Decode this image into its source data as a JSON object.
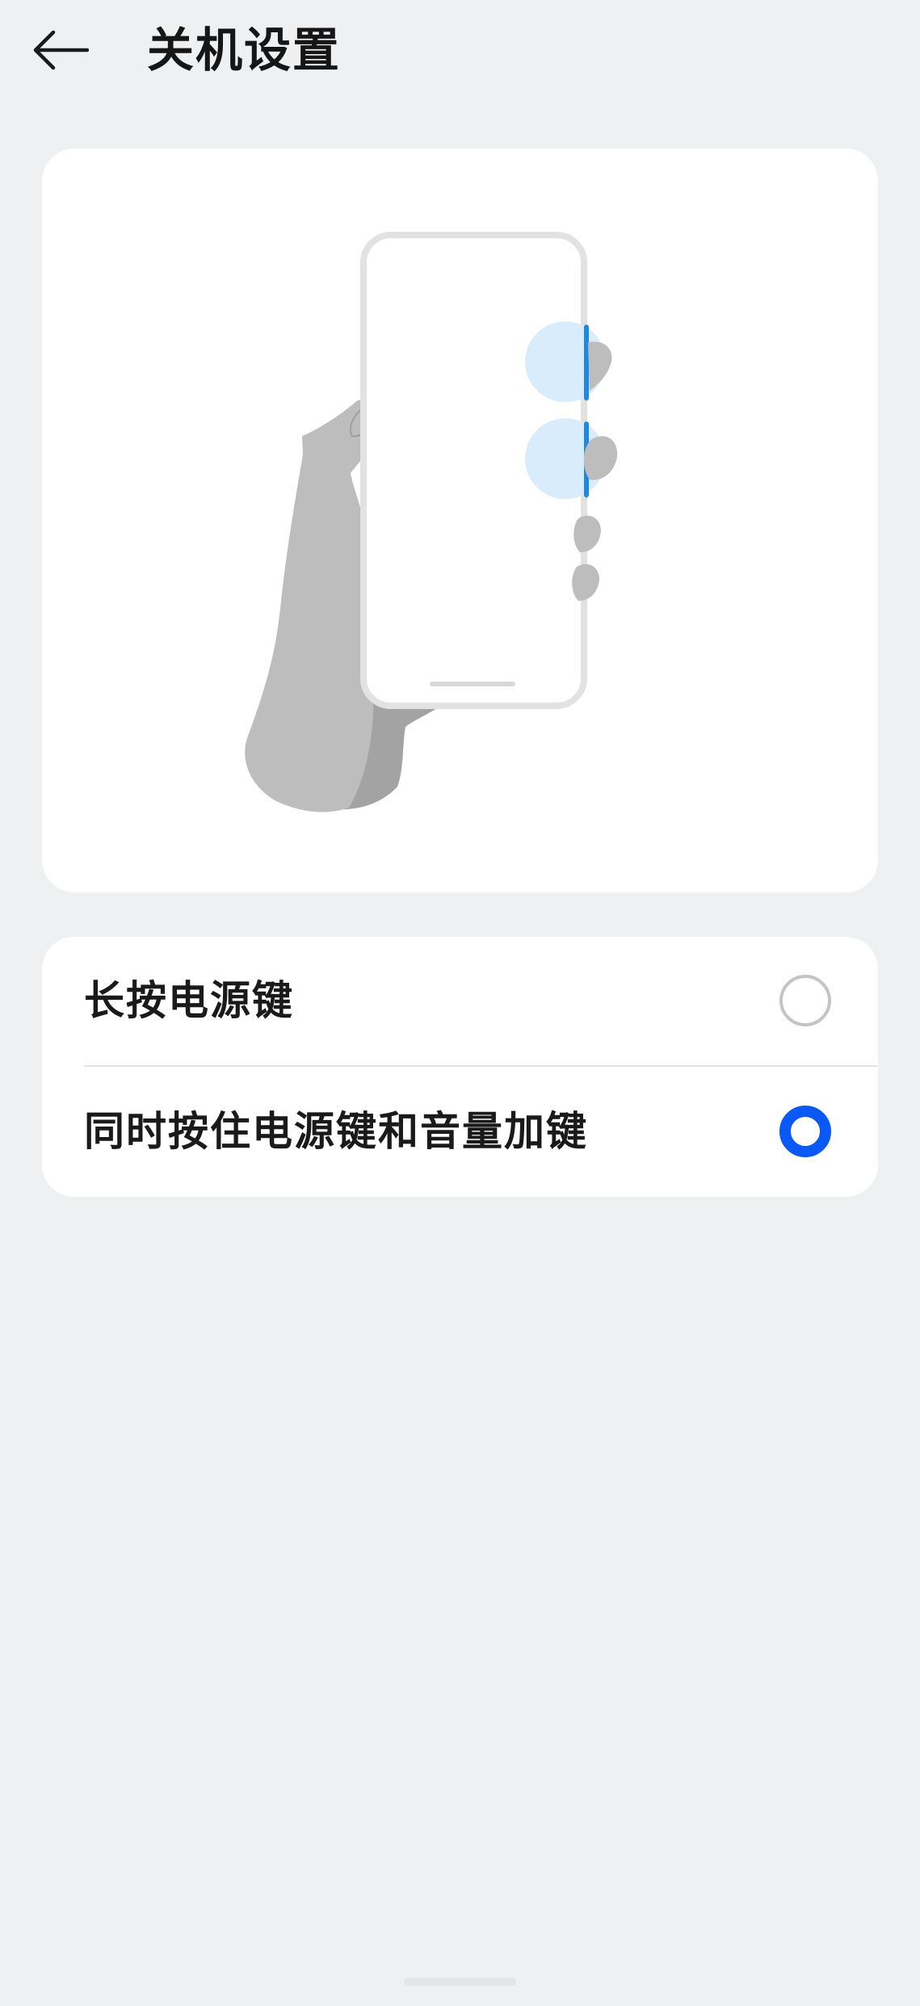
{
  "header": {
    "title": "关机设置",
    "back_icon": "arrow-left-icon"
  },
  "illustration": {
    "subject": "hand-holding-phone-illustration",
    "highlight_color": "#d9ecfb",
    "button_color": "#1e88e5"
  },
  "options": [
    {
      "label": "长按电源键",
      "selected": false
    },
    {
      "label": "同时按住电源键和音量加键",
      "selected": true
    }
  ],
  "colors": {
    "background": "#eff0f2",
    "card": "#ffffff",
    "accent": "#0a59f7",
    "radio_unselected": "#c4c4c4"
  }
}
